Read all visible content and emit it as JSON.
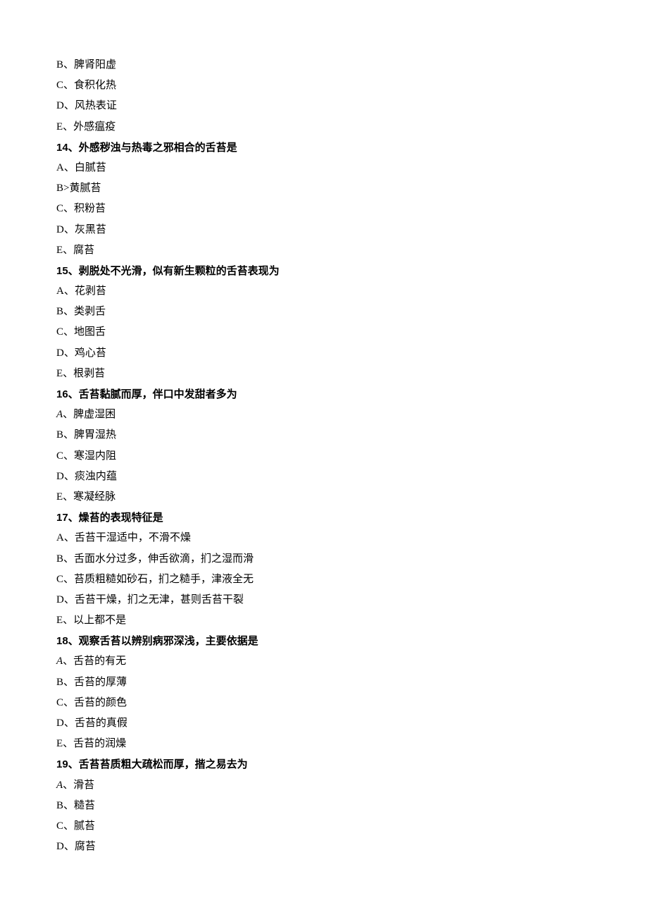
{
  "lines": [
    {
      "text": "B、脾肾阳虚",
      "bold": false
    },
    {
      "text": "C、食积化热",
      "bold": false
    },
    {
      "text": "D、风热表证",
      "bold": false
    },
    {
      "text": "E、外感瘟疫",
      "bold": false
    },
    {
      "text": "14、外感秽浊与热毒之邪相合的舌苔是",
      "bold": true
    },
    {
      "text": "A、白腻苔",
      "bold": false
    },
    {
      "text": "B>黄腻苔",
      "bold": false
    },
    {
      "text": "C、积粉苔",
      "bold": false
    },
    {
      "text": "D、灰黑苔",
      "bold": false
    },
    {
      "text": "E、腐苔",
      "bold": false
    },
    {
      "text": "15、剥脱处不光滑，似有新生颗粒的舌苔表现为",
      "bold": true
    },
    {
      "text": "A、花剥苔",
      "bold": false
    },
    {
      "text": "B、类剥舌",
      "bold": false
    },
    {
      "text": "C、地图舌",
      "bold": false
    },
    {
      "text": "D、鸡心苔",
      "bold": false
    },
    {
      "text": "E、根剥苔",
      "bold": false
    },
    {
      "text": "16、舌苔黏腻而厚，伴口中发甜者多为",
      "bold": true
    },
    {
      "prefix": "A",
      "suffix": "、脾虚湿困",
      "bold": false,
      "italicA": true
    },
    {
      "text": "B、脾胃湿热",
      "bold": false
    },
    {
      "text": "C、寒湿内阻",
      "bold": false
    },
    {
      "text": "D、痰浊内蕴",
      "bold": false
    },
    {
      "text": "E、寒凝经脉",
      "bold": false
    },
    {
      "text": "17、燥苔的表现特征是",
      "bold": true
    },
    {
      "text": "A、舌苔干湿适中，不滑不燥",
      "bold": false
    },
    {
      "text": "B、舌面水分过多，伸舌欲滴，扪之湿而滑",
      "bold": false
    },
    {
      "text": "C、苔质粗糙如砂石，扪之糙手，津液全无",
      "bold": false
    },
    {
      "text": "D、舌苔干燥，扪之无津，甚则舌苔干裂",
      "bold": false
    },
    {
      "text": "E、以上都不是",
      "bold": false
    },
    {
      "text": "18、观察舌苔以辨别病邪深浅，主要依据是",
      "bold": true
    },
    {
      "prefix": "A",
      "suffix": "、舌苔的有无",
      "bold": false,
      "italicA": true
    },
    {
      "text": "B、舌苔的厚薄",
      "bold": false
    },
    {
      "text": "C、舌苔的颜色",
      "bold": false
    },
    {
      "text": "D、舌苔的真假",
      "bold": false
    },
    {
      "text": "E、舌苔的润燥",
      "bold": false
    },
    {
      "text": "19、舌苔苔质粗大疏松而厚，揩之易去为",
      "bold": true
    },
    {
      "prefix": "A",
      "suffix": "、滑苔",
      "bold": false,
      "italicA": true
    },
    {
      "text": "B、糙苔",
      "bold": false
    },
    {
      "text": "C、腻苔",
      "bold": false
    },
    {
      "text": "D、腐苔",
      "bold": false
    }
  ]
}
